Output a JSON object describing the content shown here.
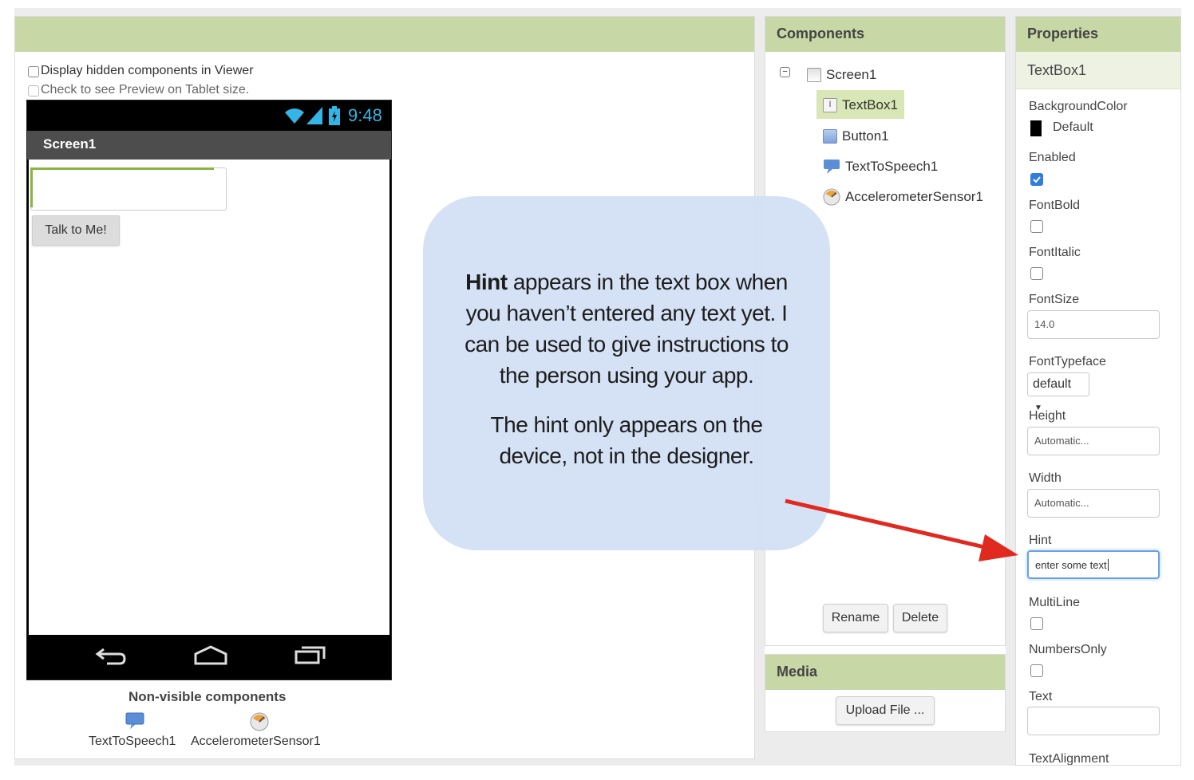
{
  "viewer": {
    "display_hidden_label": "Display hidden components in Viewer",
    "tablet_preview_label": "Check to see Preview on Tablet size.",
    "phone": {
      "time": "9:48",
      "screen_title": "Screen1",
      "button_label": "Talk to Me!"
    },
    "nonvisible": {
      "title": "Non-visible components",
      "items": [
        "TextToSpeech1",
        "AccelerometerSensor1"
      ]
    }
  },
  "callout": {
    "bold": "Hint",
    "line1_rest": " appears in the text box when",
    "line2": "you haven’t entered any text yet. I",
    "line3": "can be used to give instructions to",
    "line4": "the person using your app.",
    "line5": "The hint only appears on the",
    "line6": "device, not in the designer."
  },
  "components": {
    "title": "Components",
    "items": [
      {
        "label": "Screen1",
        "icon": "screen-icon"
      },
      {
        "label": "TextBox1",
        "icon": "textbox-icon",
        "selected": true
      },
      {
        "label": "Button1",
        "icon": "button-icon"
      },
      {
        "label": "TextToSpeech1",
        "icon": "speech-icon"
      },
      {
        "label": "AccelerometerSensor1",
        "icon": "sensor-icon"
      }
    ],
    "rename_label": "Rename",
    "delete_label": "Delete"
  },
  "media": {
    "title": "Media",
    "upload_label": "Upload File ..."
  },
  "properties": {
    "title": "Properties",
    "component_name": "TextBox1",
    "background_color_label": "BackgroundColor",
    "background_color_value": "Default",
    "enabled_label": "Enabled",
    "fontbold_label": "FontBold",
    "fontitalic_label": "FontItalic",
    "fontsize_label": "FontSize",
    "fontsize_value": "14.0",
    "fonttypeface_label": "FontTypeface",
    "fonttypeface_value": "default",
    "height_label": "Height",
    "height_value": "Automatic...",
    "width_label": "Width",
    "width_value": "Automatic...",
    "hint_label": "Hint",
    "hint_value": "enter some text",
    "multiline_label": "MultiLine",
    "numbersonly_label": "NumbersOnly",
    "text_label": "Text",
    "text_value": "",
    "textalignment_label": "TextAlignment"
  },
  "colors": {
    "header_green": "#c8d7a6",
    "callout_blue": "#d3e0f4",
    "arrow_red": "#e02a1f",
    "selected_item": "#d9e6b5"
  }
}
